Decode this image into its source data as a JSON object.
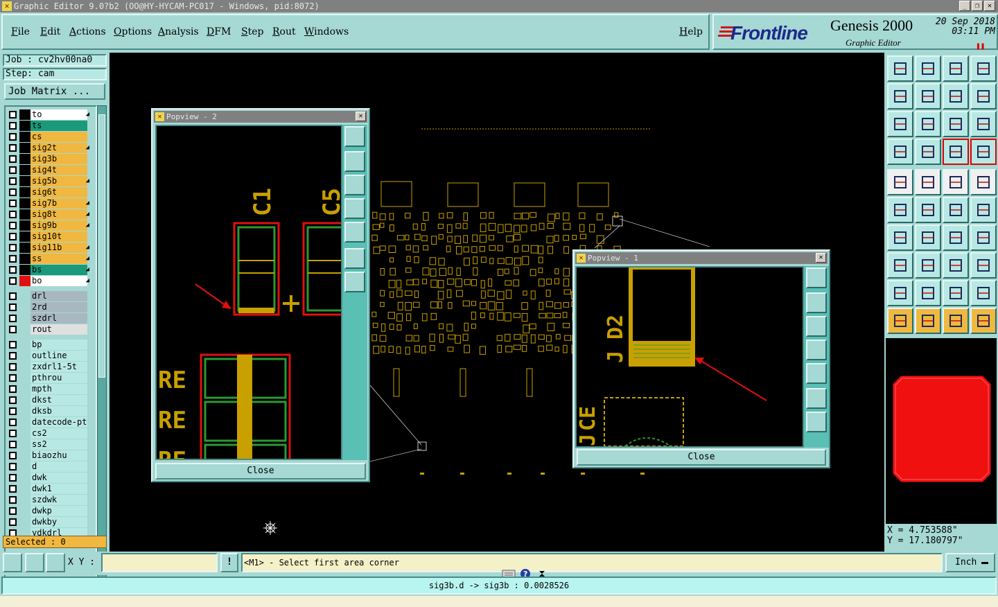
{
  "window": {
    "title": "Graphic Editor 9.0?b2 (OO@HY-HYCAM-PC017 - Windows, pid:8072)"
  },
  "menu": [
    "File",
    "Edit",
    "Actions",
    "Options",
    "Analysis",
    "DFM",
    "Step",
    "Rout",
    "Windows"
  ],
  "help_label": "Help",
  "brand": {
    "logo": "Frontline",
    "product": "Genesis 2000",
    "subtitle": "Graphic Editor",
    "date": "20 Sep 2018",
    "time": "03:11 PM"
  },
  "job": {
    "job_line": "Job : cv2hv00na0",
    "step_line": "Step: cam",
    "matrix_button": "Job Matrix ..."
  },
  "layers": [
    {
      "name": "to",
      "color": "#ffffff",
      "mark": "◢",
      "swatch": "#000000"
    },
    {
      "name": "ts",
      "color": "#1a9a7a",
      "mark": "",
      "swatch": "#000000"
    },
    {
      "name": "cs",
      "color": "#f0b840",
      "mark": "",
      "swatch": "#000000"
    },
    {
      "name": "sig2t",
      "color": "#f0b840",
      "mark": "◢",
      "swatch": "#000000"
    },
    {
      "name": "sig3b",
      "color": "#f0b840",
      "mark": "",
      "swatch": "#000000"
    },
    {
      "name": "sig4t",
      "color": "#f0b840",
      "mark": "",
      "swatch": "#000000"
    },
    {
      "name": "sig5b",
      "color": "#f0b840",
      "mark": "◢",
      "swatch": "#000000"
    },
    {
      "name": "sig6t",
      "color": "#f0b840",
      "mark": "",
      "swatch": "#000000"
    },
    {
      "name": "sig7b",
      "color": "#f0b840",
      "mark": "◢",
      "swatch": "#000000"
    },
    {
      "name": "sig8t",
      "color": "#f0b840",
      "mark": "◢",
      "swatch": "#000000"
    },
    {
      "name": "sig9b",
      "color": "#f0b840",
      "mark": "◢",
      "swatch": "#000000"
    },
    {
      "name": "sig10t",
      "color": "#f0b840",
      "mark": "",
      "swatch": "#000000"
    },
    {
      "name": "sig11b",
      "color": "#f0b840",
      "mark": "◢",
      "swatch": "#000000"
    },
    {
      "name": "ss",
      "color": "#f0b840",
      "mark": "◢",
      "swatch": "#000000"
    },
    {
      "name": "bs",
      "color": "#1a9a7a",
      "mark": "◢",
      "swatch": "#000000"
    },
    {
      "name": "bo",
      "color": "#ffffff",
      "mark": "◢",
      "swatch": "#e01010"
    },
    {
      "name": "drl",
      "color": "#a8b8c0",
      "mark": "",
      "swatch": "#a6d8d4"
    },
    {
      "name": "2rd",
      "color": "#a8b8c0",
      "mark": "",
      "swatch": "#a6d8d4"
    },
    {
      "name": "szdrl",
      "color": "#a8b8c0",
      "mark": "",
      "swatch": "#a6d8d4"
    },
    {
      "name": "rout",
      "color": "#e0e0e0",
      "mark": "",
      "swatch": "#a6d8d4"
    },
    {
      "name": "bp",
      "color": "#b8e8e4",
      "mark": "",
      "swatch": "#a6d8d4"
    },
    {
      "name": "outline",
      "color": "#b8e8e4",
      "mark": "",
      "swatch": "#a6d8d4"
    },
    {
      "name": "zxdrl1-5t",
      "color": "#b8e8e4",
      "mark": "",
      "swatch": "#a6d8d4"
    },
    {
      "name": "pthrou",
      "color": "#b8e8e4",
      "mark": "",
      "swatch": "#a6d8d4"
    },
    {
      "name": "mpth",
      "color": "#b8e8e4",
      "mark": "",
      "swatch": "#a6d8d4"
    },
    {
      "name": "dkst",
      "color": "#b8e8e4",
      "mark": "",
      "swatch": "#a6d8d4"
    },
    {
      "name": "dksb",
      "color": "#b8e8e4",
      "mark": "",
      "swatch": "#a6d8d4"
    },
    {
      "name": "datecode-pt",
      "color": "#b8e8e4",
      "mark": "",
      "swatch": "#a6d8d4"
    },
    {
      "name": "cs2",
      "color": "#b8e8e4",
      "mark": "",
      "swatch": "#a6d8d4"
    },
    {
      "name": "ss2",
      "color": "#b8e8e4",
      "mark": "",
      "swatch": "#a6d8d4"
    },
    {
      "name": "biaozhu",
      "color": "#b8e8e4",
      "mark": "",
      "swatch": "#a6d8d4"
    },
    {
      "name": "d",
      "color": "#b8e8e4",
      "mark": "",
      "swatch": "#a6d8d4"
    },
    {
      "name": "dwk",
      "color": "#b8e8e4",
      "mark": "",
      "swatch": "#a6d8d4"
    },
    {
      "name": "dwk1",
      "color": "#b8e8e4",
      "mark": "",
      "swatch": "#a6d8d4"
    },
    {
      "name": "szdwk",
      "color": "#b8e8e4",
      "mark": "",
      "swatch": "#a6d8d4"
    },
    {
      "name": "dwkp",
      "color": "#b8e8e4",
      "mark": "",
      "swatch": "#a6d8d4"
    },
    {
      "name": "dwkby",
      "color": "#b8e8e4",
      "mark": "",
      "swatch": "#a6d8d4"
    },
    {
      "name": "ydkdrl",
      "color": "#b8e8e4",
      "mark": "",
      "swatch": "#a6d8d4"
    }
  ],
  "selected": "Selected : 0",
  "popview2": {
    "title": "Popview - 2",
    "close": "Close",
    "labels": [
      "C1",
      "C5",
      "RE",
      "RE",
      "RE"
    ]
  },
  "popview1": {
    "title": "Popview - 1",
    "close": "Close",
    "labels": [
      "D2",
      "J",
      "CE",
      "J"
    ]
  },
  "coords": {
    "x": "X = 4.753588\"",
    "y": "Y = 17.180797\""
  },
  "xy_label": "X Y :",
  "xy_value": "",
  "message": "<M1> - Select first area corner",
  "units": "Inch",
  "status": "sig3b.d -> sig3b : 0.0028526",
  "colors": {
    "accent": "#a6d8d4",
    "canvas": "#000000",
    "pad_fill": "#c8a000",
    "outline_red": "#e01010",
    "pad_green": "#2a9a30"
  }
}
